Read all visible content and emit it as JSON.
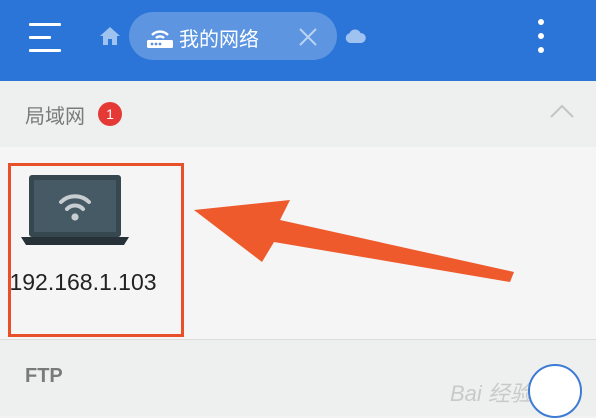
{
  "appbar": {
    "menu_icon": "hamburger-menu-icon",
    "home_icon": "home-icon",
    "tab": {
      "icon": "router-icon",
      "label": "我的网络",
      "close_icon": "close-icon"
    },
    "cloud_icon": "cloud-icon",
    "more_icon": "more-vertical-icon",
    "color": "#2b74d8"
  },
  "lan_section": {
    "title": "局域网",
    "badge": "1",
    "collapse_icon": "chevron-up-icon",
    "devices": [
      {
        "name": "192.168.1.103",
        "icon": "laptop-wifi-icon"
      }
    ]
  },
  "annotation": {
    "highlight_color": "#e8502a",
    "arrow_color": "#ee5a2c"
  },
  "ftp_section": {
    "title": "FTP"
  },
  "watermark": {
    "text": "Bai 经验"
  }
}
